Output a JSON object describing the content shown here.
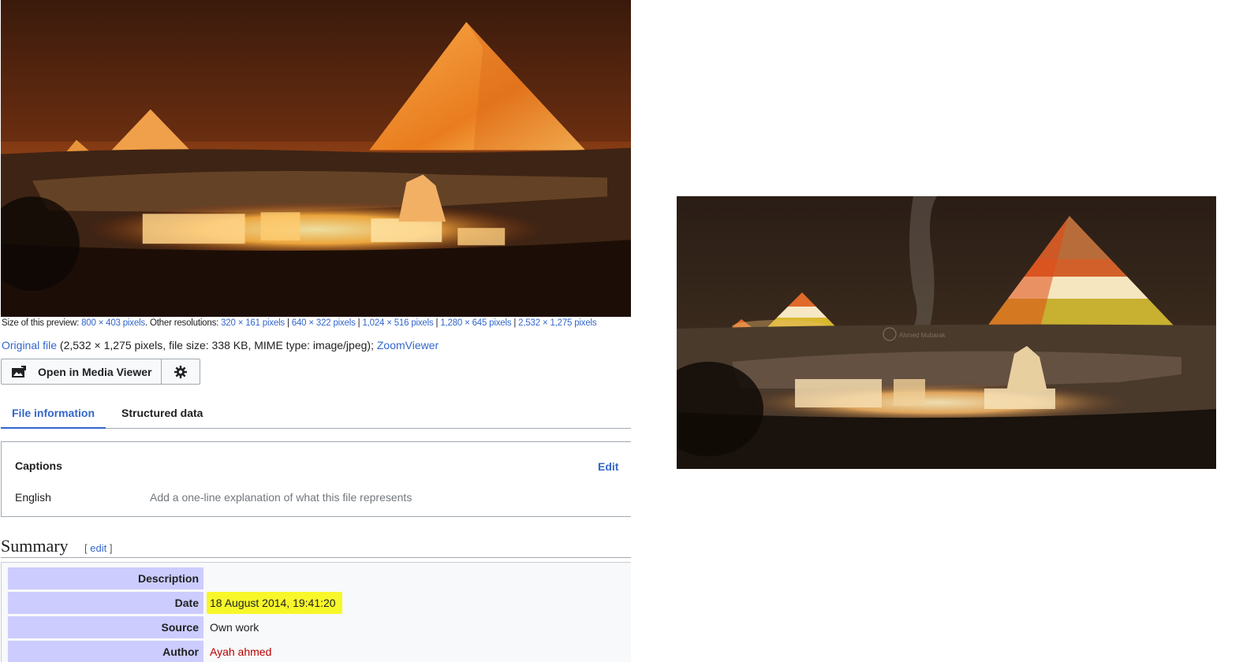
{
  "preview": {
    "size_label": "Size of this preview: ",
    "size_link": "800 × 403 pixels",
    "other_label": ". Other resolutions: ",
    "resolutions": [
      "320 × 161 pixels",
      "640 × 322 pixels",
      "1,024 × 516 pixels",
      "1,280 × 645 pixels",
      "2,532 × 1,275 pixels"
    ],
    "separator": " | "
  },
  "original": {
    "link": "Original file",
    "details": " (2,532 × 1,275 pixels, file size: 338 KB, MIME type: image/jpeg); ",
    "zoom_link": "ZoomViewer"
  },
  "buttons": {
    "open_media_viewer": "Open in Media Viewer",
    "media_icon": "image-viewer-icon",
    "settings_icon": "gear-icon"
  },
  "tabs": [
    {
      "label": "File information",
      "active": true
    },
    {
      "label": "Structured data",
      "active": false
    }
  ],
  "captions": {
    "title": "Captions",
    "edit": "Edit",
    "language": "English",
    "placeholder": "Add a one-line explanation of what this file represents"
  },
  "summary": {
    "title": "Summary",
    "edit_open": "[ ",
    "edit": "edit",
    "edit_close": " ]",
    "rows": [
      {
        "label": "Description",
        "value": ""
      },
      {
        "label": "Date",
        "value": "18 August 2014, 19:41:20"
      },
      {
        "label": "Source",
        "value": "Own work"
      },
      {
        "label": "Author",
        "value": "Ayah ahmed"
      }
    ]
  },
  "colors": {
    "link": "#3366cc",
    "label_bg": "#ccccff",
    "highlight": "#f7f72a",
    "author_link": "#ba0000"
  },
  "right_image": {
    "watermark": "Ahmed Mubarak"
  }
}
